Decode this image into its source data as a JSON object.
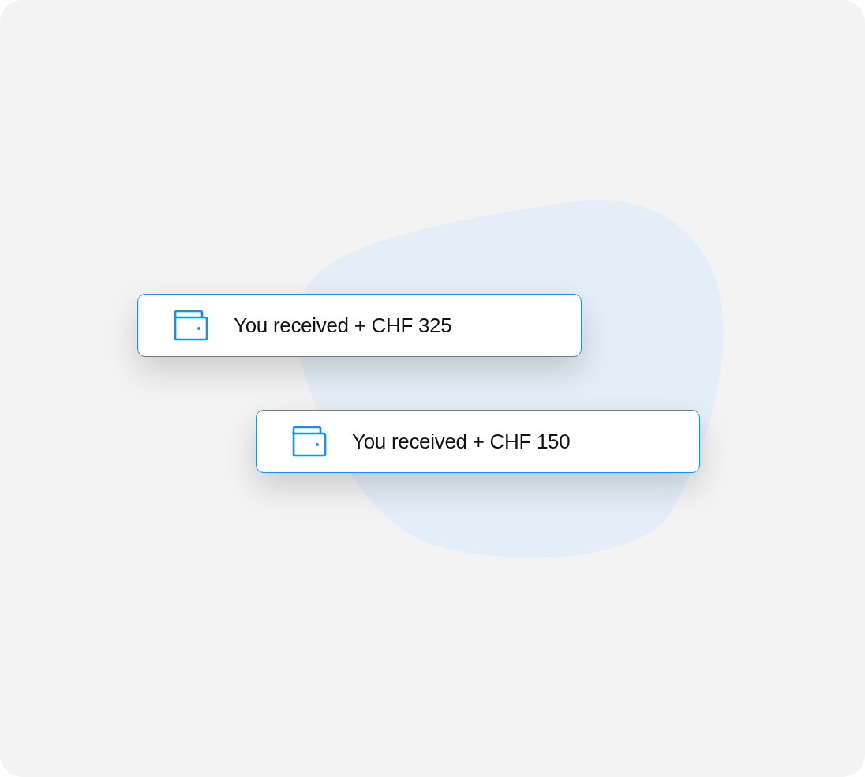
{
  "notifications": [
    {
      "text": "You received + CHF 325"
    },
    {
      "text": "You received + CHF 150"
    }
  ]
}
